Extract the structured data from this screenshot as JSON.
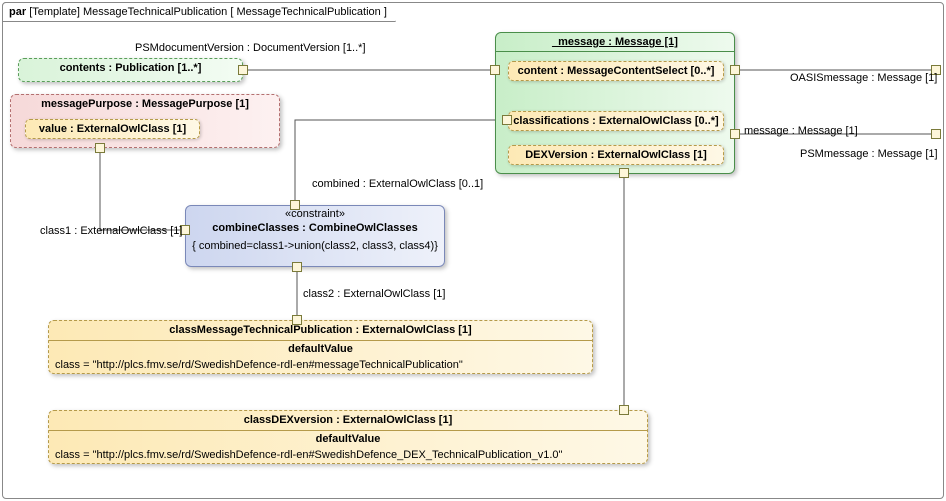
{
  "frame": {
    "kw": "par",
    "title": "[Template] MessageTechnicalPublication [ MessageTechnicalPublication ]"
  },
  "contents": {
    "title": "contents : Publication [1..*]"
  },
  "messagePurpose": {
    "title": "messagePurpose : MessagePurpose [1]",
    "value": "value : ExternalOwlClass [1]"
  },
  "message": {
    "title": "_message : Message [1]",
    "content": "content : MessageContentSelect [0..*]",
    "classifications": "classifications : ExternalOwlClass [0..*]",
    "dex": "DEXVersion : ExternalOwlClass [1]"
  },
  "combine": {
    "stereo": "«constraint»",
    "title": "combineClasses : CombineOwlClasses",
    "body": "{ combined=class1->union(class2, class3, class4)}"
  },
  "cls2": {
    "title": "classMessageTechnicalPublication : ExternalOwlClass [1]",
    "dvLabel": "defaultValue",
    "dv": "class = \"http://plcs.fmv.se/rd/SwedishDefence-rdl-en#messageTechnicalPublication\""
  },
  "clsDex": {
    "title": "classDEXversion : ExternalOwlClass [1]",
    "dvLabel": "defaultValue",
    "dv": "class = \"http://plcs.fmv.se/rd/SwedishDefence-rdl-en#SwedishDefence_DEX_TechnicalPublication_v1.0\""
  },
  "edges": {
    "psmDocVer": "PSMdocumentVersion : DocumentVersion [1..*]",
    "combined": "combined : ExternalOwlClass [0..1]",
    "class1": "class1 : ExternalOwlClass [1]",
    "class2": "class2 : ExternalOwlClass [1]",
    "oasis": "OASISmessage : Message [1]",
    "msg": "message : Message [1]",
    "psmMsg": "PSMmessage : Message [1]"
  }
}
